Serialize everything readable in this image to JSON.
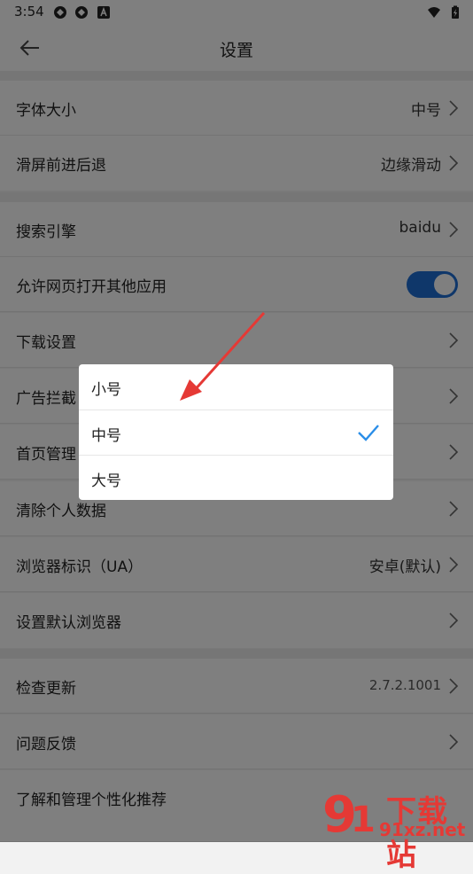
{
  "status_bar": {
    "time": "3:54"
  },
  "header": {
    "title": "设置"
  },
  "settings": [
    {
      "label": "字体大小",
      "value": "中号"
    },
    {
      "label": "滑屏前进后退",
      "value": "边缘滑动"
    },
    {
      "label": "搜索引擎",
      "value": "baidu"
    },
    {
      "label": "允许网页打开其他应用",
      "toggle_on": true
    },
    {
      "label": "下载设置",
      "value": ""
    },
    {
      "label": "广告拦截",
      "value": ""
    },
    {
      "label": "首页管理",
      "value": ""
    },
    {
      "label": "清除个人数据",
      "value": ""
    },
    {
      "label": "浏览器标识（UA）",
      "value": "安卓(默认)"
    },
    {
      "label": "设置默认浏览器",
      "value": ""
    },
    {
      "label": "检查更新",
      "value": "2.7.2.1001"
    },
    {
      "label": "问题反馈",
      "value": ""
    },
    {
      "label": "了解和管理个性化推荐",
      "value": ""
    }
  ],
  "dialog": {
    "options": [
      {
        "label": "小号",
        "selected": false
      },
      {
        "label": "中号",
        "selected": true
      },
      {
        "label": "大号",
        "selected": false
      }
    ]
  },
  "watermark": {
    "line1": "下载站",
    "line2": "91xz.net"
  },
  "colors": {
    "accent": "#1e6ed4",
    "check": "#2a8ee8",
    "annotation": "#e53935"
  }
}
